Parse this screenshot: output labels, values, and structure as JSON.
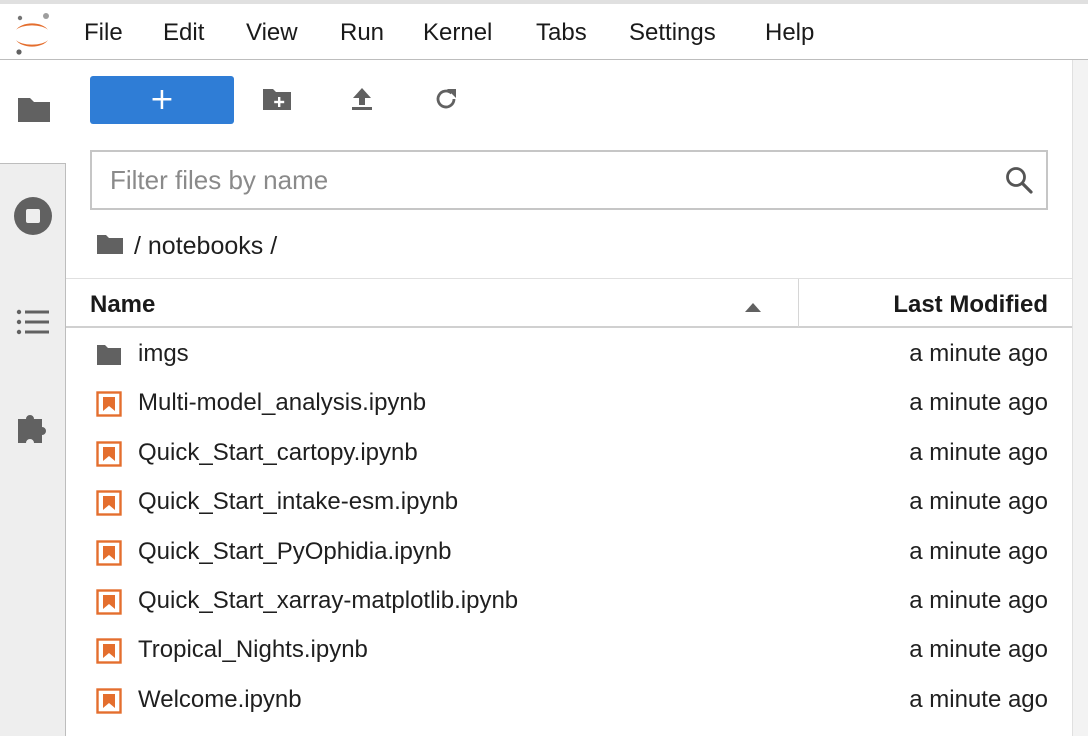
{
  "menubar": {
    "logo_icon": "jupyter-logo-icon",
    "items": [
      "File",
      "Edit",
      "View",
      "Run",
      "Kernel",
      "Tabs",
      "Settings",
      "Help"
    ]
  },
  "sidebar": {
    "tabs": [
      {
        "icon": "folder-icon",
        "active": true
      },
      {
        "icon": "stop-circle-icon",
        "active": false
      },
      {
        "icon": "list-icon",
        "active": false
      },
      {
        "icon": "puzzle-icon",
        "active": false
      }
    ]
  },
  "toolbar": {
    "new_label": "+",
    "new_folder_icon": "new-folder-icon",
    "upload_icon": "upload-icon",
    "refresh_icon": "refresh-icon"
  },
  "filter": {
    "placeholder": "Filter files by name",
    "value": ""
  },
  "breadcrumb": {
    "path": "/ notebooks /"
  },
  "list": {
    "col_name": "Name",
    "col_modified": "Last Modified",
    "sort": "ascending",
    "items": [
      {
        "type": "folder",
        "name": "imgs",
        "modified": "a minute ago"
      },
      {
        "type": "notebook",
        "name": "Multi-model_analysis.ipynb",
        "modified": "a minute ago"
      },
      {
        "type": "notebook",
        "name": "Quick_Start_cartopy.ipynb",
        "modified": "a minute ago"
      },
      {
        "type": "notebook",
        "name": "Quick_Start_intake-esm.ipynb",
        "modified": "a minute ago"
      },
      {
        "type": "notebook",
        "name": "Quick_Start_PyOphidia.ipynb",
        "modified": "a minute ago"
      },
      {
        "type": "notebook",
        "name": "Quick_Start_xarray-matplotlib.ipynb",
        "modified": "a minute ago"
      },
      {
        "type": "notebook",
        "name": "Tropical_Nights.ipynb",
        "modified": "a minute ago"
      },
      {
        "type": "notebook",
        "name": "Welcome.ipynb",
        "modified": "a minute ago"
      }
    ]
  },
  "colors": {
    "accent": "#2f7dd6",
    "notebook_icon": "#e46e2e",
    "folder_icon": "#616161"
  }
}
